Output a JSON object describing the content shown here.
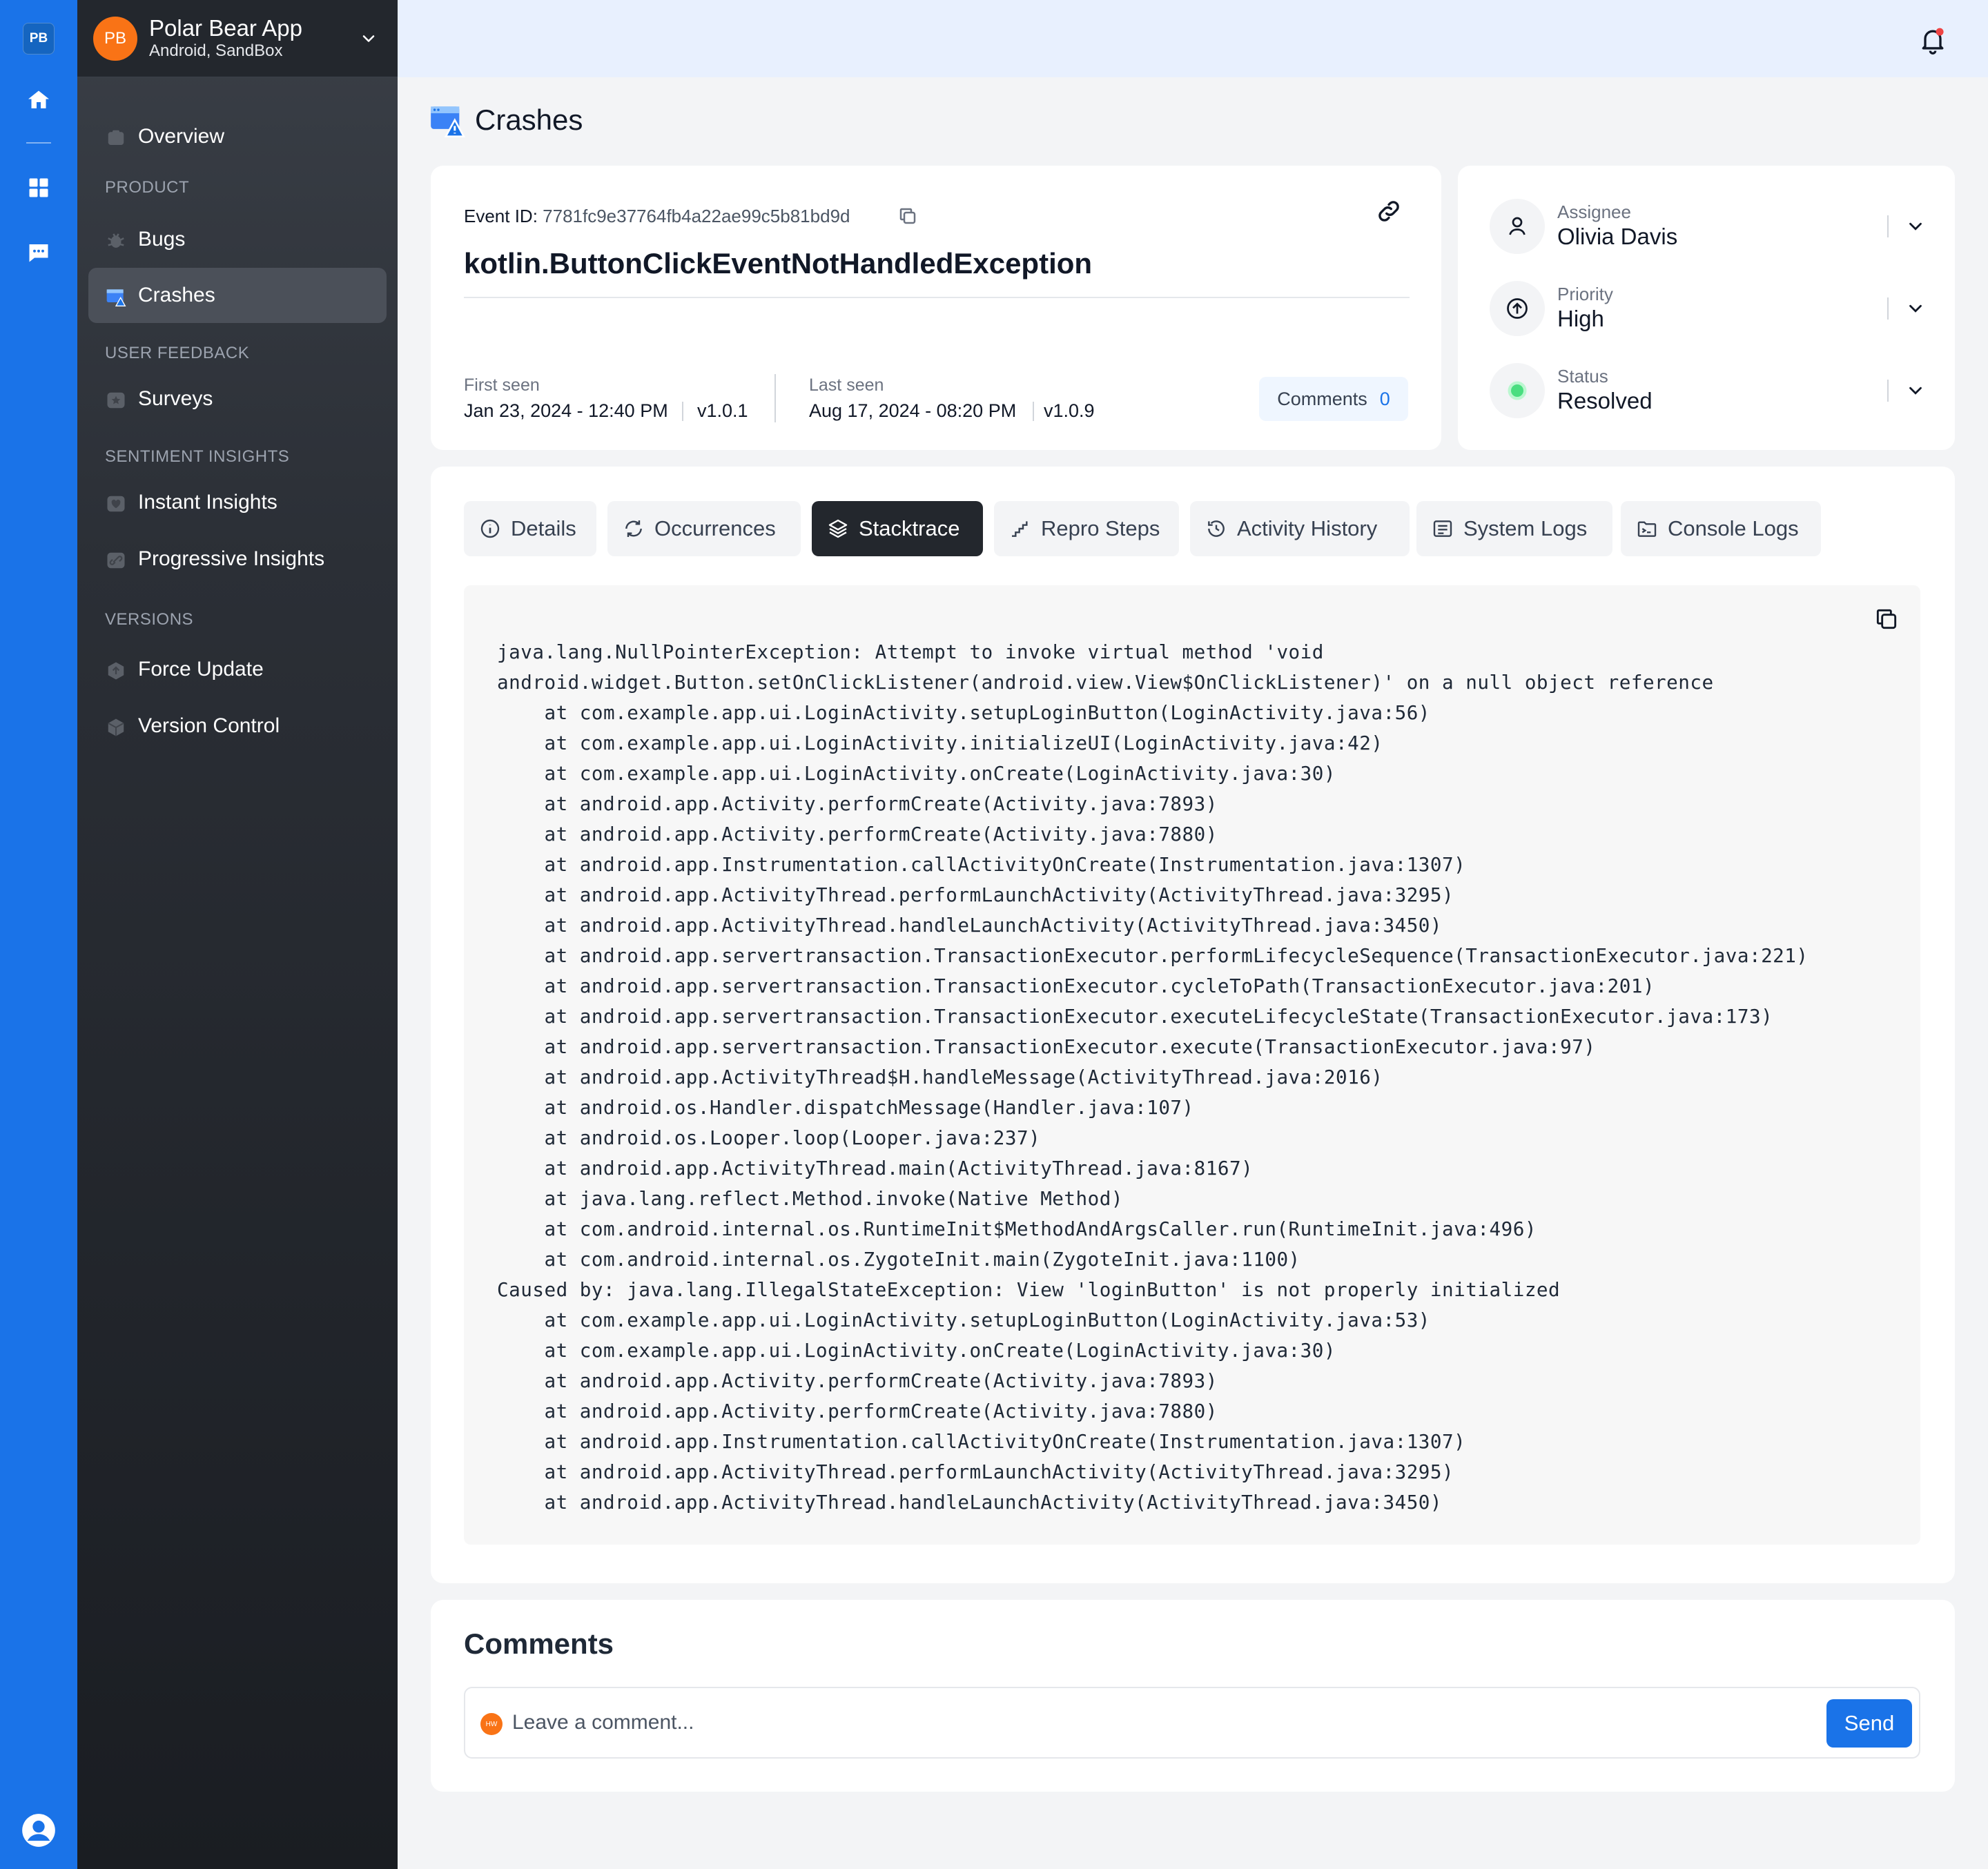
{
  "rail": {
    "badge": "PB",
    "icons": [
      "home-icon",
      "grid-icon",
      "chat-icon",
      "user-circle-icon"
    ]
  },
  "app": {
    "avatar": "PB",
    "name": "Polar Bear App",
    "subtitle": "Android, SandBox"
  },
  "nav": {
    "overview": "Overview",
    "section_product": "PRODUCT",
    "bugs": "Bugs",
    "crashes": "Crashes",
    "section_user_feedback": "USER FEEDBACK",
    "surveys": "Surveys",
    "section_sentiment": "SENTIMENT INSIGHTS",
    "instant_insights": "Instant Insights",
    "progressive_insights": "Progressive Insights",
    "section_versions": "VERSIONS",
    "force_update": "Force Update",
    "version_control": "Version Control"
  },
  "page": {
    "title": "Crashes"
  },
  "event": {
    "id_label": "Event ID: ",
    "id": "7781fc9e37764fb4a22ae99c5b81bd9d",
    "exception": "kotlin.ButtonClickEventNotHandledException",
    "first_seen_label": "First seen",
    "first_seen": "Jan 23, 2024 - 12:40 PM",
    "first_version": "v1.0.1",
    "last_seen_label": "Last seen",
    "last_seen": "Aug 17, 2024 - 08:20 PM",
    "last_version": "v1.0.9",
    "comments_label": "Comments",
    "comments_count": "0"
  },
  "properties": {
    "assignee_label": "Assignee",
    "assignee": "Olivia Davis",
    "priority_label": "Priority",
    "priority": "High",
    "status_label": "Status",
    "status": "Resolved",
    "status_color": "#4ade80"
  },
  "tabs": {
    "details": "Details",
    "occurrences": "Occurrences",
    "stacktrace": "Stacktrace",
    "repro_steps": "Repro Steps",
    "activity_history": "Activity History",
    "system_logs": "System Logs",
    "console_logs": "Console Logs",
    "active": "Stacktrace"
  },
  "stacktrace": [
    "java.lang.NullPointerException: Attempt to invoke virtual method 'void",
    "android.widget.Button.setOnClickListener(android.view.View$OnClickListener)' on a null object reference",
    "    at com.example.app.ui.LoginActivity.setupLoginButton(LoginActivity.java:56)",
    "    at com.example.app.ui.LoginActivity.initializeUI(LoginActivity.java:42)",
    "    at com.example.app.ui.LoginActivity.onCreate(LoginActivity.java:30)",
    "    at android.app.Activity.performCreate(Activity.java:7893)",
    "    at android.app.Activity.performCreate(Activity.java:7880)",
    "    at android.app.Instrumentation.callActivityOnCreate(Instrumentation.java:1307)",
    "    at android.app.ActivityThread.performLaunchActivity(ActivityThread.java:3295)",
    "    at android.app.ActivityThread.handleLaunchActivity(ActivityThread.java:3450)",
    "    at android.app.servertransaction.TransactionExecutor.performLifecycleSequence(TransactionExecutor.java:221)",
    "    at android.app.servertransaction.TransactionExecutor.cycleToPath(TransactionExecutor.java:201)",
    "    at android.app.servertransaction.TransactionExecutor.executeLifecycleState(TransactionExecutor.java:173)",
    "    at android.app.servertransaction.TransactionExecutor.execute(TransactionExecutor.java:97)",
    "    at android.app.ActivityThread$H.handleMessage(ActivityThread.java:2016)",
    "    at android.os.Handler.dispatchMessage(Handler.java:107)",
    "    at android.os.Looper.loop(Looper.java:237)",
    "    at android.app.ActivityThread.main(ActivityThread.java:8167)",
    "    at java.lang.reflect.Method.invoke(Native Method)",
    "    at com.android.internal.os.RuntimeInit$MethodAndArgsCaller.run(RuntimeInit.java:496)",
    "    at com.android.internal.os.ZygoteInit.main(ZygoteInit.java:1100)",
    "Caused by: java.lang.IllegalStateException: View 'loginButton' is not properly initialized",
    "    at com.example.app.ui.LoginActivity.setupLoginButton(LoginActivity.java:53)",
    "    at com.example.app.ui.LoginActivity.onCreate(LoginActivity.java:30)",
    "    at android.app.Activity.performCreate(Activity.java:7893)",
    "    at android.app.Activity.performCreate(Activity.java:7880)",
    "    at android.app.Instrumentation.callActivityOnCreate(Instrumentation.java:1307)",
    "    at android.app.ActivityThread.performLaunchActivity(ActivityThread.java:3295)",
    "    at android.app.ActivityThread.handleLaunchActivity(ActivityThread.java:3450)"
  ],
  "comments": {
    "title": "Comments",
    "avatar": "HW",
    "placeholder": "Leave a comment...",
    "send": "Send"
  },
  "colors": {
    "brand": "#1a73e8",
    "avatar": "#f97316"
  }
}
